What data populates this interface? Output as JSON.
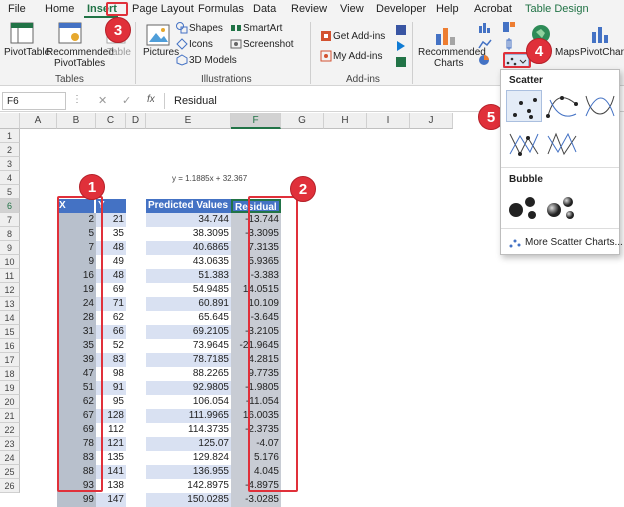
{
  "menubar": {
    "items": [
      "File",
      "Home",
      "Insert",
      "Page Layout",
      "Formulas",
      "Data",
      "Review",
      "View",
      "Developer",
      "Help",
      "Acrobat",
      "Table Design"
    ]
  },
  "ribbon": {
    "tables": {
      "pivot": "PivotTable",
      "rec": "Recommended",
      "rec2": "PivotTables",
      "table": "Table",
      "label": "Tables"
    },
    "illus": {
      "pictures": "Pictures",
      "shapes": "Shapes",
      "icons": "Icons",
      "models": "3D Models",
      "smartart": "SmartArt",
      "screenshot": "Screenshot",
      "label": "Illustrations"
    },
    "addins": {
      "get": "Get Add-ins",
      "my": "My Add-ins",
      "label": "Add-ins"
    },
    "charts": {
      "rec": "Recommended",
      "rec2": "Charts",
      "maps": "Maps",
      "pivotchart": "PivotChart"
    }
  },
  "formula_bar": {
    "name_box": "F6",
    "fx": "fx",
    "value": "Residual"
  },
  "columns": [
    "A",
    "B",
    "C",
    "D",
    "E",
    "F",
    "G",
    "H",
    "I",
    "J"
  ],
  "rows": [
    "1",
    "2",
    "3",
    "4",
    "5",
    "6",
    "7",
    "8",
    "9",
    "10",
    "11",
    "12",
    "13",
    "14",
    "15",
    "16",
    "17",
    "18",
    "19",
    "20",
    "21",
    "22",
    "23",
    "24",
    "25",
    "26"
  ],
  "equation": "y = 1.1885x + 32.367",
  "table": {
    "headers": {
      "x": "X",
      "y": "Y",
      "pred": "Predicted Values",
      "resid": "Residual"
    },
    "x": [
      "2",
      "5",
      "7",
      "9",
      "16",
      "19",
      "24",
      "28",
      "31",
      "35",
      "39",
      "47",
      "51",
      "62",
      "67",
      "69",
      "78",
      "83",
      "88",
      "93",
      "99"
    ],
    "y": [
      "21",
      "35",
      "48",
      "49",
      "48",
      "69",
      "71",
      "62",
      "66",
      "52",
      "83",
      "98",
      "91",
      "95",
      "128",
      "112",
      "121",
      "135",
      "141",
      "138",
      "147"
    ],
    "pred": [
      "34.744",
      "38.3095",
      "40.6865",
      "43.0635",
      "51.383",
      "54.9485",
      "60.891",
      "65.645",
      "69.2105",
      "73.9645",
      "78.7185",
      "88.2265",
      "92.9805",
      "106.054",
      "111.9965",
      "114.3735",
      "125.07",
      "129.824",
      "136.955",
      "142.8975",
      "150.0285"
    ],
    "resid": [
      "-13.744",
      "-3.3095",
      "7.3135",
      "5.9365",
      "-3.383",
      "14.0515",
      "10.109",
      "-3.645",
      "-3.2105",
      "-21.9645",
      "4.2815",
      "9.7735",
      "-1.9805",
      "-11.054",
      "16.0035",
      "-2.3735",
      "-4.07",
      "5.176",
      "4.045",
      "-4.8975",
      "-3.0285"
    ]
  },
  "dropdown": {
    "scatter": "Scatter",
    "bubble": "Bubble",
    "more": "More Scatter Charts..."
  },
  "badges": [
    "1",
    "2",
    "3",
    "4",
    "5"
  ],
  "colors": {
    "accent": "#217346",
    "highlight": "#e0303a",
    "table_header": "#4472c4"
  }
}
